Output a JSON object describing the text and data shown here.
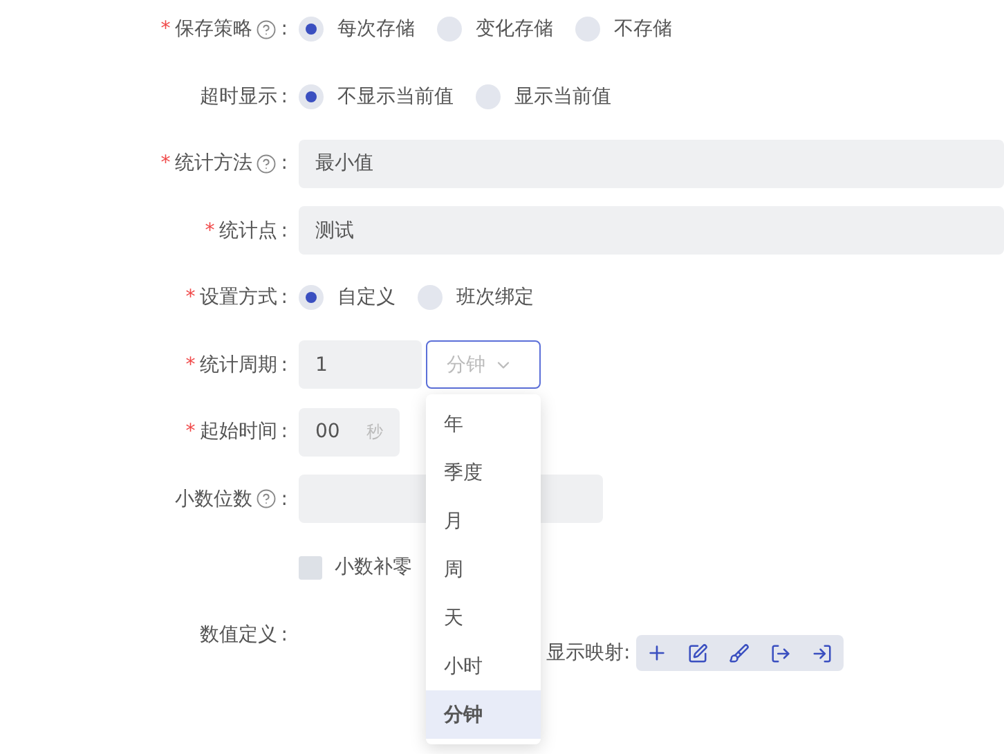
{
  "fields": [
    {
      "kind": "radio",
      "required_mark": "*",
      "label": "保存策略",
      "help": true,
      "colon": ":",
      "options": [
        {
          "label": "每次存储",
          "selected": true
        },
        {
          "label": "变化存储",
          "selected": false
        },
        {
          "label": "不存储",
          "selected": false
        }
      ]
    },
    {
      "kind": "radio",
      "label": "超时显示",
      "colon": ":",
      "options": [
        {
          "label": "不显示当前值",
          "selected": true
        },
        {
          "label": "显示当前值",
          "selected": false
        }
      ]
    },
    {
      "kind": "text",
      "required_mark": "*",
      "label": "统计方法",
      "help": true,
      "colon": ":",
      "value": "最小值"
    },
    {
      "kind": "text",
      "required_mark": "*",
      "label": "统计点",
      "colon": ":",
      "value": "测试"
    },
    {
      "kind": "radio",
      "required_mark": "*",
      "label": "设置方式",
      "colon": ":",
      "options": [
        {
          "label": "自定义",
          "selected": true
        },
        {
          "label": "班次绑定",
          "selected": false
        }
      ]
    },
    {
      "kind": "period",
      "required_mark": "*",
      "label": "统计周期",
      "colon": ":",
      "value": "1",
      "unit": "分钟",
      "open": true,
      "menu": [
        {
          "label": "年",
          "selected": false
        },
        {
          "label": "季度",
          "selected": false
        },
        {
          "label": "月",
          "selected": false
        },
        {
          "label": "周",
          "selected": false
        },
        {
          "label": "天",
          "selected": false
        },
        {
          "label": "小时",
          "selected": false
        },
        {
          "label": "分钟",
          "selected": true
        }
      ]
    },
    {
      "kind": "time",
      "required_mark": "*",
      "label": "起始时间",
      "colon": ":",
      "value": "00",
      "suffix": "秒"
    },
    {
      "kind": "number",
      "label": "小数位数",
      "help": true,
      "colon": ":"
    },
    {
      "kind": "checkbox",
      "text": "小数补零",
      "checked": false
    },
    {
      "kind": "mapping",
      "label": "数值定义",
      "colon": ":",
      "mapping_label": "显示映射:"
    }
  ]
}
